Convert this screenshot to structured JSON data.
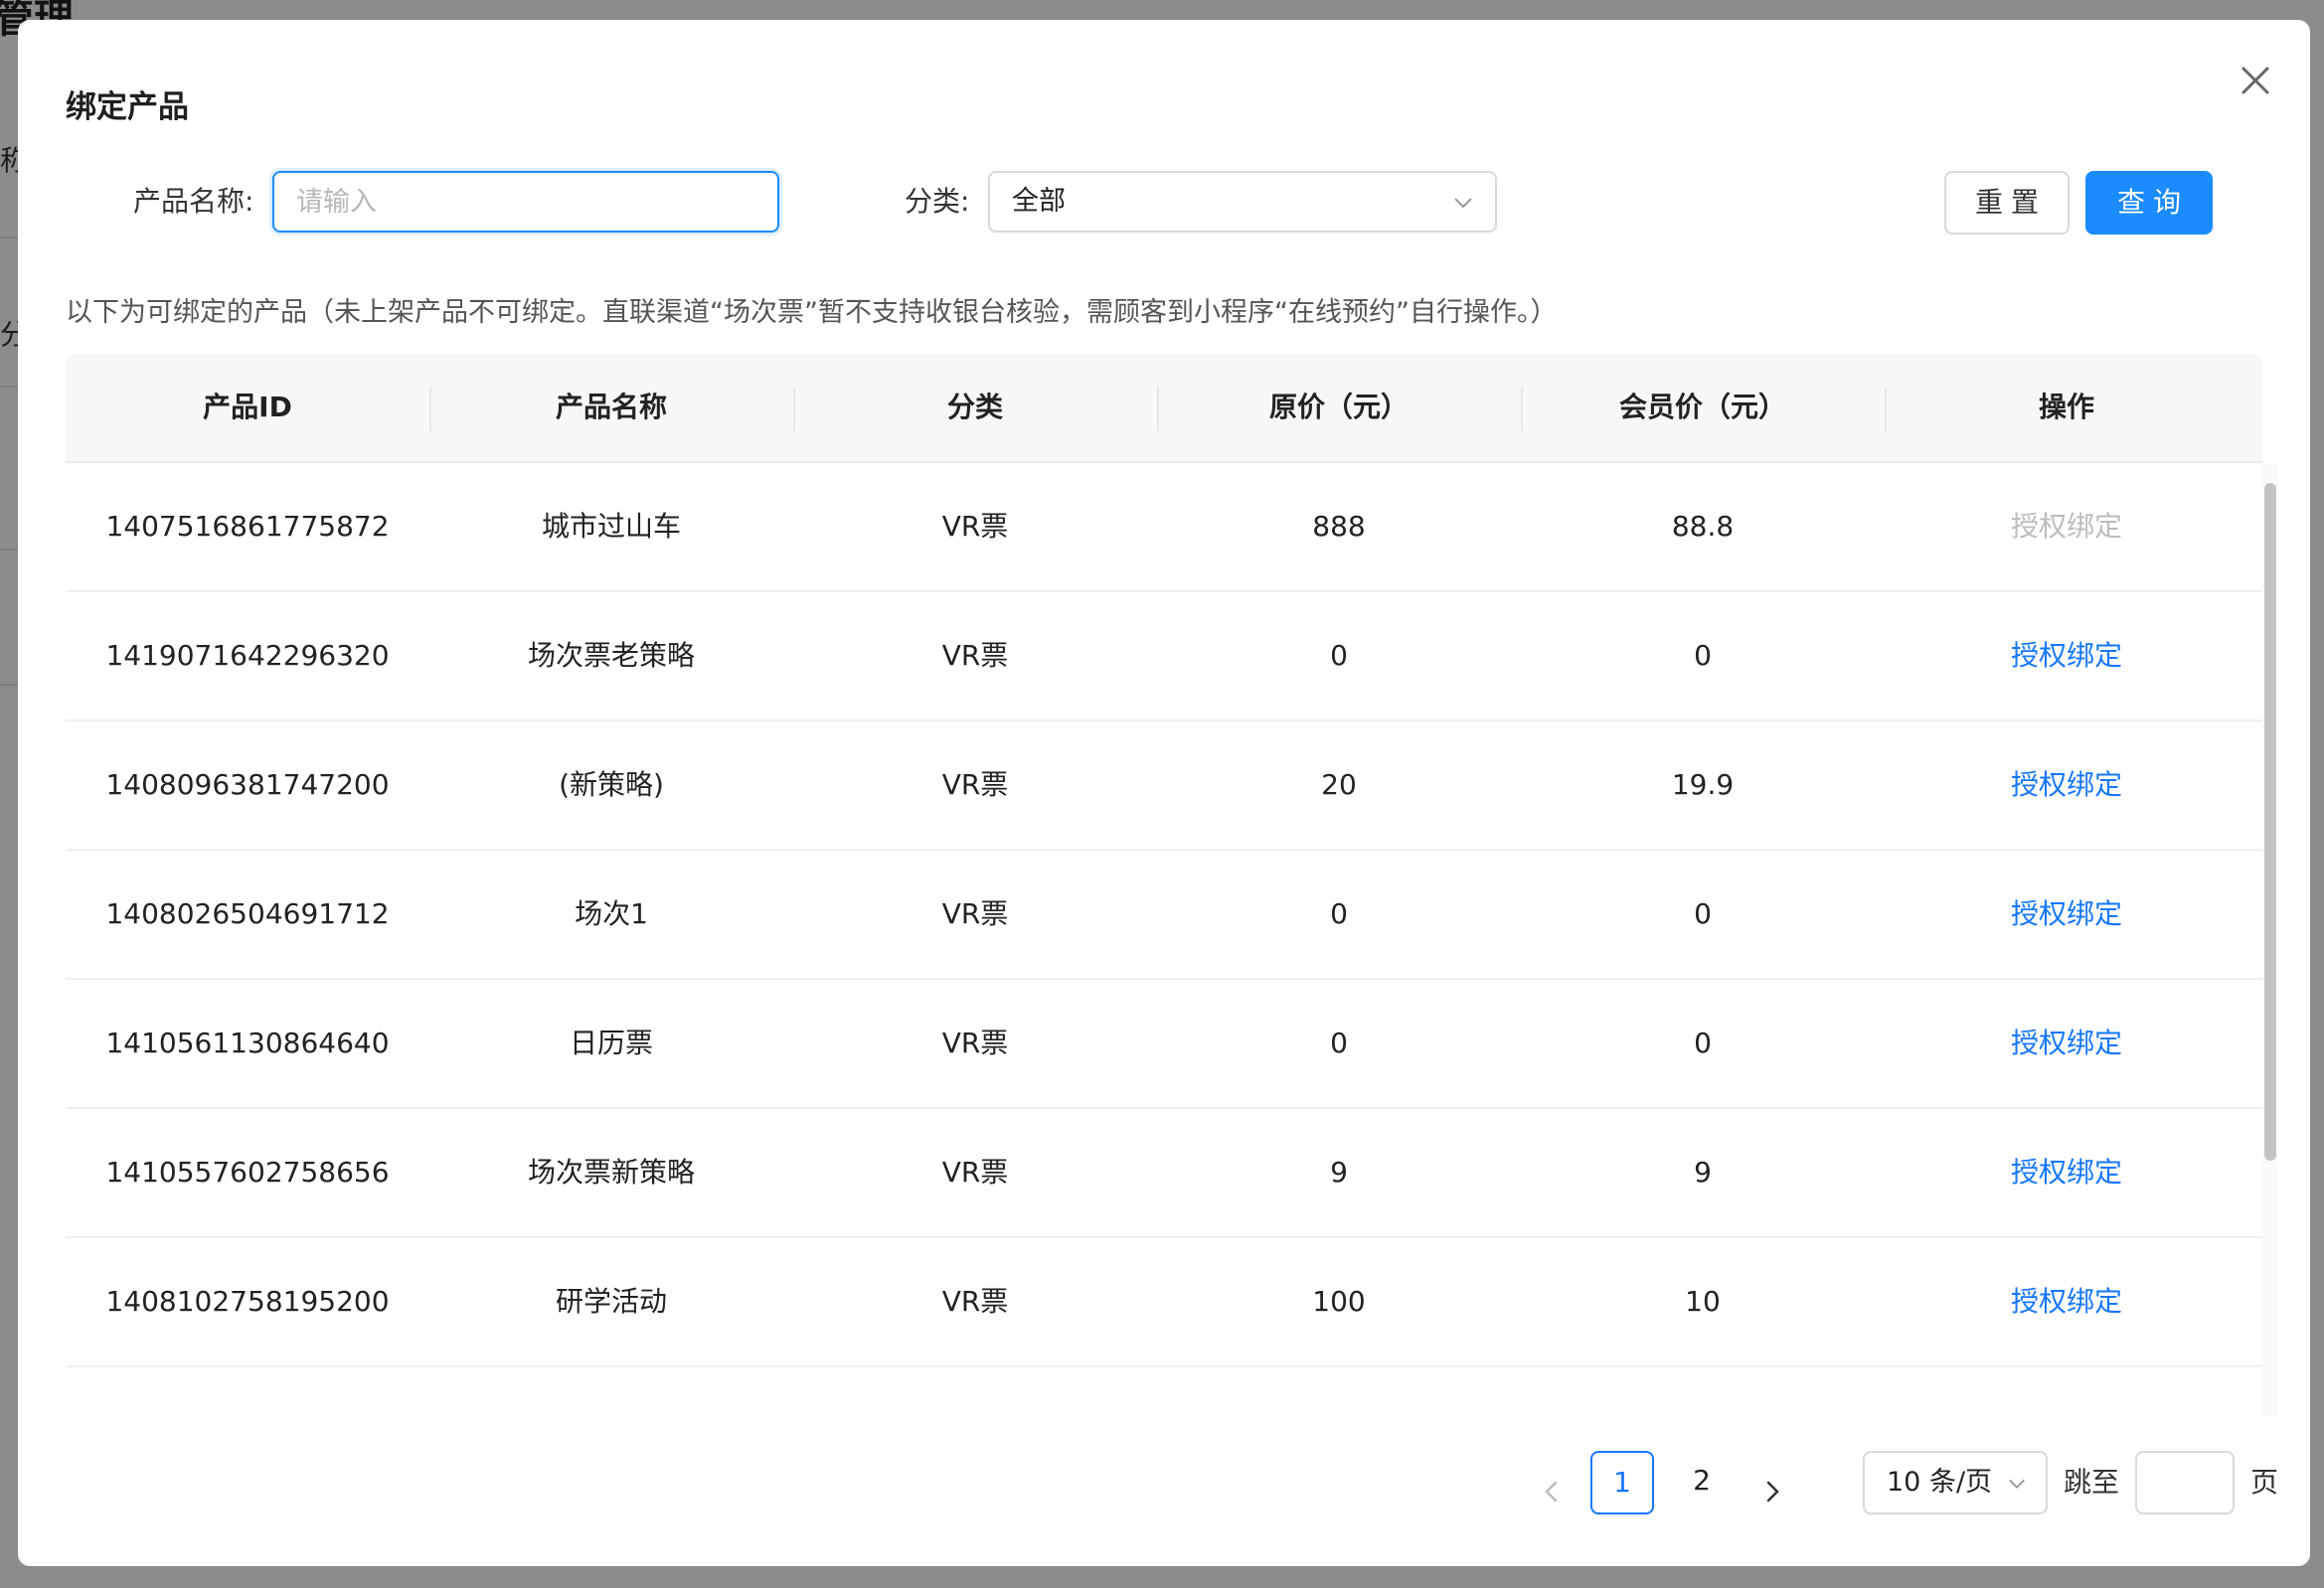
{
  "background": {
    "title": "管理",
    "label1": "称",
    "label2": "分"
  },
  "modal": {
    "title": "绑定产品",
    "close_icon": "close-icon"
  },
  "filters": {
    "name_label": "产品名称:",
    "name_placeholder": "请输入",
    "category_label": "分类:",
    "category_value": "全部",
    "reset_label": "重置",
    "query_label": "查询"
  },
  "notice": "以下为可绑定的产品（未上架产品不可绑定。直联渠道“场次票”暂不支持收银台核验，需顾客到小程序“在线预约”自行操作。）",
  "table": {
    "headers": [
      "产品ID",
      "产品名称",
      "分类",
      "原价（元）",
      "会员价（元）",
      "操作"
    ],
    "rows": [
      {
        "id": "1407516861775872",
        "name": "城市过山车",
        "category": "VR票",
        "price": "888",
        "member_price": "88.8",
        "action": "授权绑定",
        "disabled": true
      },
      {
        "id": "1419071642296320",
        "name": "场次票老策略",
        "category": "VR票",
        "price": "0",
        "member_price": "0",
        "action": "授权绑定",
        "disabled": false
      },
      {
        "id": "1408096381747200",
        "name": "(新策略)",
        "category": "VR票",
        "price": "20",
        "member_price": "19.9",
        "action": "授权绑定",
        "disabled": false
      },
      {
        "id": "1408026504691712",
        "name": "场次1",
        "category": "VR票",
        "price": "0",
        "member_price": "0",
        "action": "授权绑定",
        "disabled": false
      },
      {
        "id": "1410561130864640",
        "name": "日历票",
        "category": "VR票",
        "price": "0",
        "member_price": "0",
        "action": "授权绑定",
        "disabled": false
      },
      {
        "id": "1410557602758656",
        "name": "场次票新策略",
        "category": "VR票",
        "price": "9",
        "member_price": "9",
        "action": "授权绑定",
        "disabled": false
      },
      {
        "id": "1408102758195200",
        "name": "研学活动",
        "category": "VR票",
        "price": "100",
        "member_price": "10",
        "action": "授权绑定",
        "disabled": false
      }
    ]
  },
  "pagination": {
    "pages": [
      "1",
      "2"
    ],
    "current": "1",
    "page_size": "10 条/页",
    "jump_label": "跳至",
    "page_suffix": "页"
  },
  "colors": {
    "primary": "#1a8cff",
    "link": "#1677ff",
    "disabled": "#bcbcbc"
  }
}
